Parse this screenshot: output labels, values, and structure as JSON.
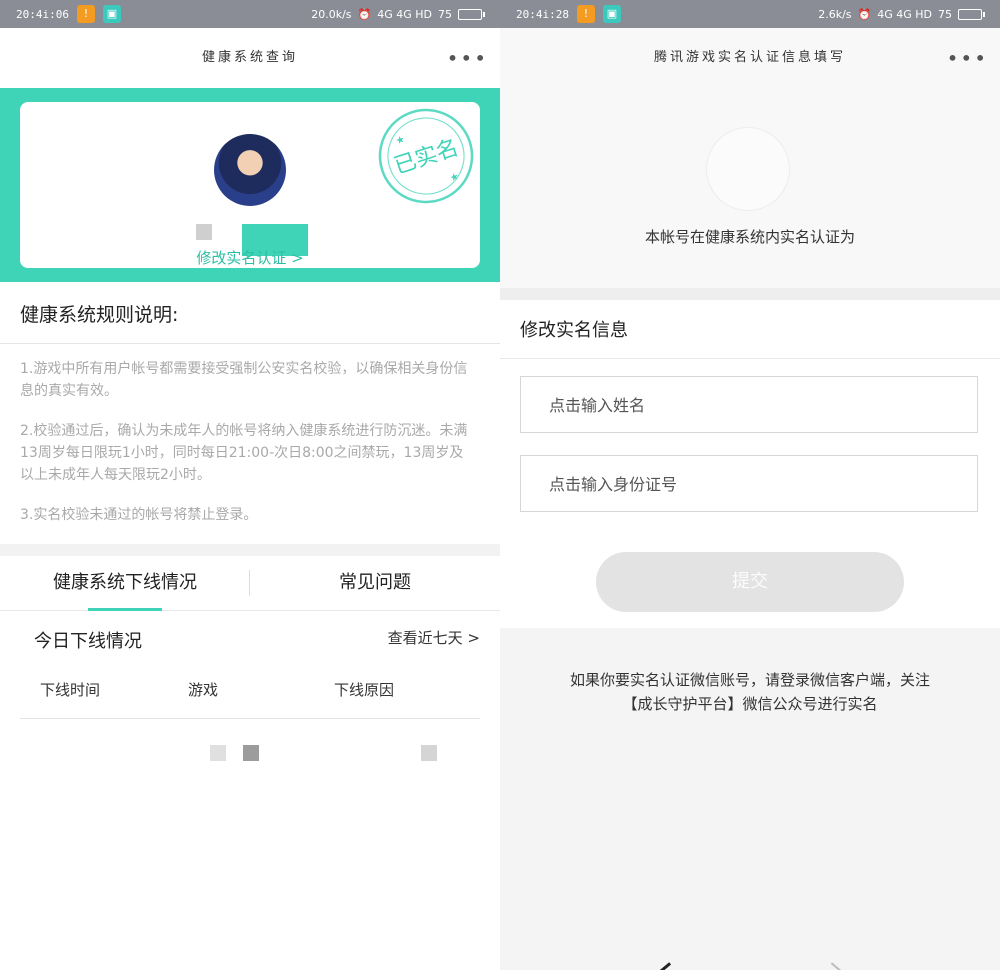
{
  "left": {
    "status": {
      "time": "20:4i:06",
      "net_speed": "20.0k/s",
      "signal": "4G 4G HD",
      "battery": "75"
    },
    "title": "健康系统查询",
    "more_label": "•••",
    "card": {
      "stamp_text": "已实名",
      "edit_link": "修改实名认证 >"
    },
    "rules_title": "健康系统规则说明:",
    "rules": [
      "1.游戏中所有用户帐号都需要接受强制公安实名校验，以确保相关身份信息的真实有效。",
      "2.校验通过后，确认为未成年人的帐号将纳入健康系统进行防沉迷。未满13周岁每日限玩1小时，同时每日21:00-次日8:00之间禁玩，13周岁及以上未成年人每天限玩2小时。",
      "3.实名校验未通过的帐号将禁止登录。"
    ],
    "tabs": [
      "健康系统下线情况",
      "常见问题"
    ],
    "today_title": "今日下线情况",
    "view_week": "查看近七天 >",
    "table_headers": [
      "下线时间",
      "游戏",
      "下线原因"
    ]
  },
  "right": {
    "status": {
      "time": "20:4i:28",
      "net_speed": "2.6k/s",
      "signal": "4G 4G HD",
      "battery": "75"
    },
    "title": "腾讯游戏实名认证信息填写",
    "more_label": "•••",
    "status_text": "本帐号在健康系统内实名认证为",
    "form_title": "修改实名信息",
    "name_placeholder": "点击输入姓名",
    "id_placeholder": "点击输入身份证号",
    "submit_label": "提交",
    "note_line1": "如果你要实名认证微信账号，请登录微信客户端，关注",
    "note_line2": "【成长守护平台】微信公众号进行实名"
  },
  "colors": {
    "accent": "#3fd3b8",
    "link": "#2bbfa3",
    "status_bar": "#8a8d95"
  }
}
